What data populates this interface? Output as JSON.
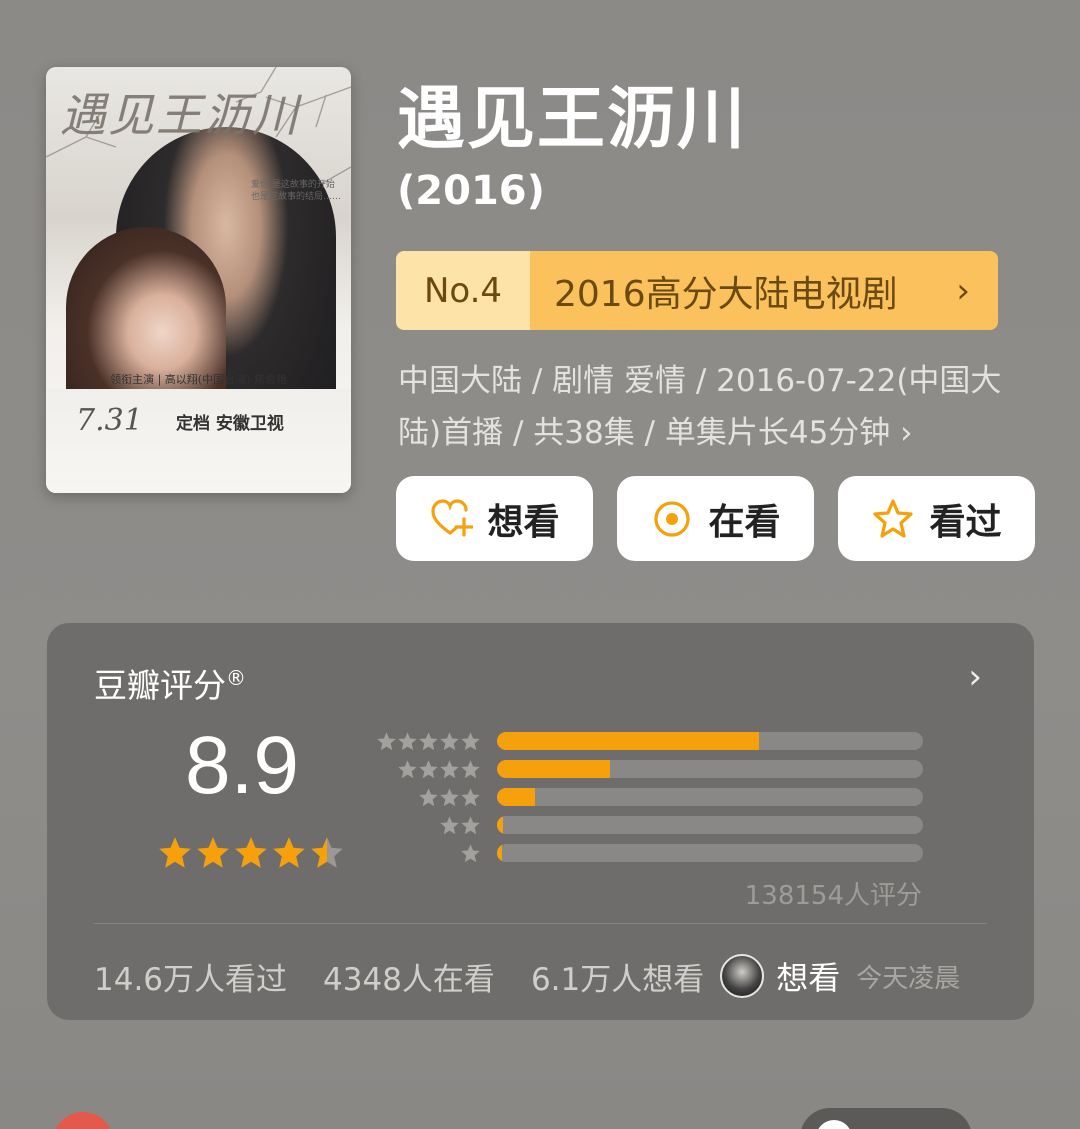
{
  "poster": {
    "title_art": "遇见王沥川",
    "tagline": "爱你 是这故事的开始 也是这故事的结局……",
    "credits": "领衔主演 | 高以翔(中国台湾)  焦俊艳",
    "date": "7.31",
    "channel": "定档 安徽卫视"
  },
  "show": {
    "title": "遇见王沥川",
    "year": "(2016)"
  },
  "rank": {
    "number": "No.4",
    "list_name": "2016高分大陆电视剧",
    "chevron": "›"
  },
  "meta_text": "中国大陆 / 剧情 爱情 / 2016-07-22(中国大陆)首播 / 共38集 / 单集片长45分钟 ›",
  "actions": {
    "want": "想看",
    "watching": "在看",
    "watched": "看过"
  },
  "rating": {
    "header": "豆瓣评分",
    "registered": "®",
    "chevron": "›",
    "score": "8.9",
    "stars_value": 4.5,
    "distribution": [
      {
        "stars": 5,
        "fraction": 0.615
      },
      {
        "stars": 4,
        "fraction": 0.265
      },
      {
        "stars": 3,
        "fraction": 0.09
      },
      {
        "stars": 2,
        "fraction": 0.015
      },
      {
        "stars": 1,
        "fraction": 0.01
      }
    ],
    "count": "138154人评分",
    "watched": "14.6万人看过",
    "watching": "4348人在看",
    "want": "6.1万人想看",
    "friend_action": "想看",
    "friend_time": "今天凌晨"
  },
  "colors": {
    "accent": "#f6a10b",
    "rank_light": "#fde3a8",
    "rank_dark": "#fbc15c"
  }
}
